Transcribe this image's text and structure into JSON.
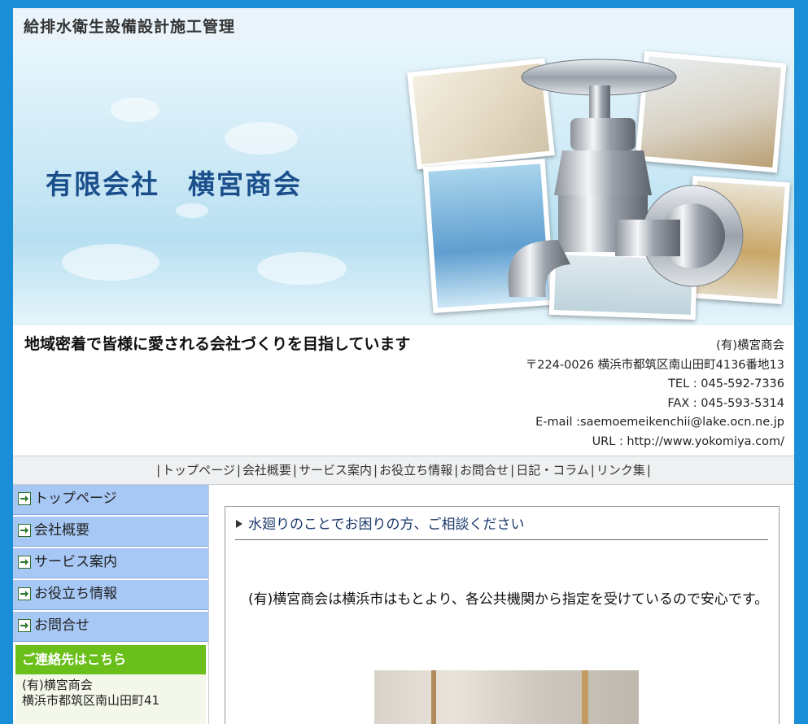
{
  "header": {
    "title": "給排水衛生設備設計施工管理"
  },
  "hero": {
    "company_name": "有限会社　横宮商会"
  },
  "info": {
    "tagline": "地域密着で皆様に愛される会社づくりを目指しています",
    "contact_lines": [
      "(有)横宮商会",
      "〒224-0026 横浜市都筑区南山田町4136番地13",
      "TEL : 045-592-7336",
      "FAX : 045-593-5314",
      "E-mail :saemoemeikenchii@lake.ocn.ne.jp",
      "URL : http://www.yokomiya.com/"
    ]
  },
  "navbar": {
    "items": [
      "トップページ",
      "会社概要",
      "サービス案内",
      "お役立ち情報",
      "お問合せ",
      "日記・コラム",
      "リンク集"
    ],
    "separator": "|"
  },
  "sidebar": {
    "items": [
      {
        "label": "トップページ"
      },
      {
        "label": "会社概要"
      },
      {
        "label": "サービス案内"
      },
      {
        "label": "お役立ち情報"
      },
      {
        "label": "お問合せ"
      }
    ],
    "contact_heading": "ご連絡先はこちら",
    "contact_lines": [
      "(有)横宮商会",
      " 横浜市都筑区南山田町41"
    ]
  },
  "main": {
    "panel_title": "水廻りのことでお困りの方、ご相談ください",
    "intro_text": "(有)横宮商会は横浜市はもとより、各公共機関から指定を受けているので安心です。"
  },
  "colors": {
    "background": "#1a8ed6",
    "sidebar_item": "#a7c8f5",
    "contact_heading": "#6bbf1a",
    "company_name": "#1b4f8c"
  }
}
